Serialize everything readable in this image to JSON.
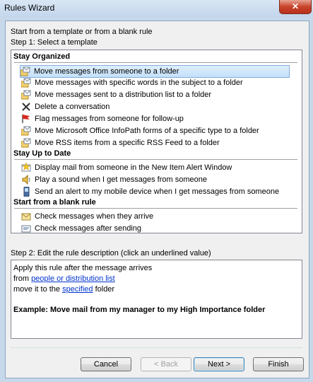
{
  "window": {
    "title": "Rules Wizard",
    "close_glyph": "✕"
  },
  "intro": {
    "line1": "Start from a template or from a blank rule",
    "step1": "Step 1: Select a template"
  },
  "groups": [
    {
      "header": "Stay Organized",
      "items": [
        {
          "label": "Move messages from someone to a folder",
          "icon": "envelope-folder-icon",
          "selected": true
        },
        {
          "label": "Move messages with specific words in the subject to a folder",
          "icon": "envelope-folder-icon"
        },
        {
          "label": "Move messages sent to a distribution list to a folder",
          "icon": "envelope-folder-icon"
        },
        {
          "label": "Delete a conversation",
          "icon": "delete-x-icon"
        },
        {
          "label": "Flag messages from someone for follow-up",
          "icon": "red-flag-icon"
        },
        {
          "label": "Move Microsoft Office InfoPath forms of a specific type to a folder",
          "icon": "envelope-folder-icon"
        },
        {
          "label": "Move RSS items from a specific RSS Feed to a folder",
          "icon": "envelope-folder-icon"
        }
      ]
    },
    {
      "header": "Stay Up to Date",
      "items": [
        {
          "label": "Display mail from someone in the New Item Alert Window",
          "icon": "alert-window-icon"
        },
        {
          "label": "Play a sound when I get messages from someone",
          "icon": "speaker-icon"
        },
        {
          "label": "Send an alert to my mobile device when I get messages from someone",
          "icon": "mobile-device-icon"
        }
      ]
    },
    {
      "header": "Start from a blank rule",
      "items": [
        {
          "label": "Check messages when they arrive",
          "icon": "envelope-icon"
        },
        {
          "label": "Check messages after sending",
          "icon": "sent-envelope-icon"
        }
      ]
    }
  ],
  "step2": {
    "label": "Step 2: Edit the rule description (click an underlined value)",
    "line1": "Apply this rule after the message arrives",
    "line2_prefix": "from ",
    "line2_link": "people or distribution list",
    "line3_prefix": "move it to the ",
    "line3_link": "specified",
    "line3_suffix": " folder",
    "example": "Example: Move mail from my manager to my High Importance folder"
  },
  "buttons": {
    "cancel": "Cancel",
    "back": "< Back",
    "next": "Next >",
    "finish": "Finish"
  }
}
